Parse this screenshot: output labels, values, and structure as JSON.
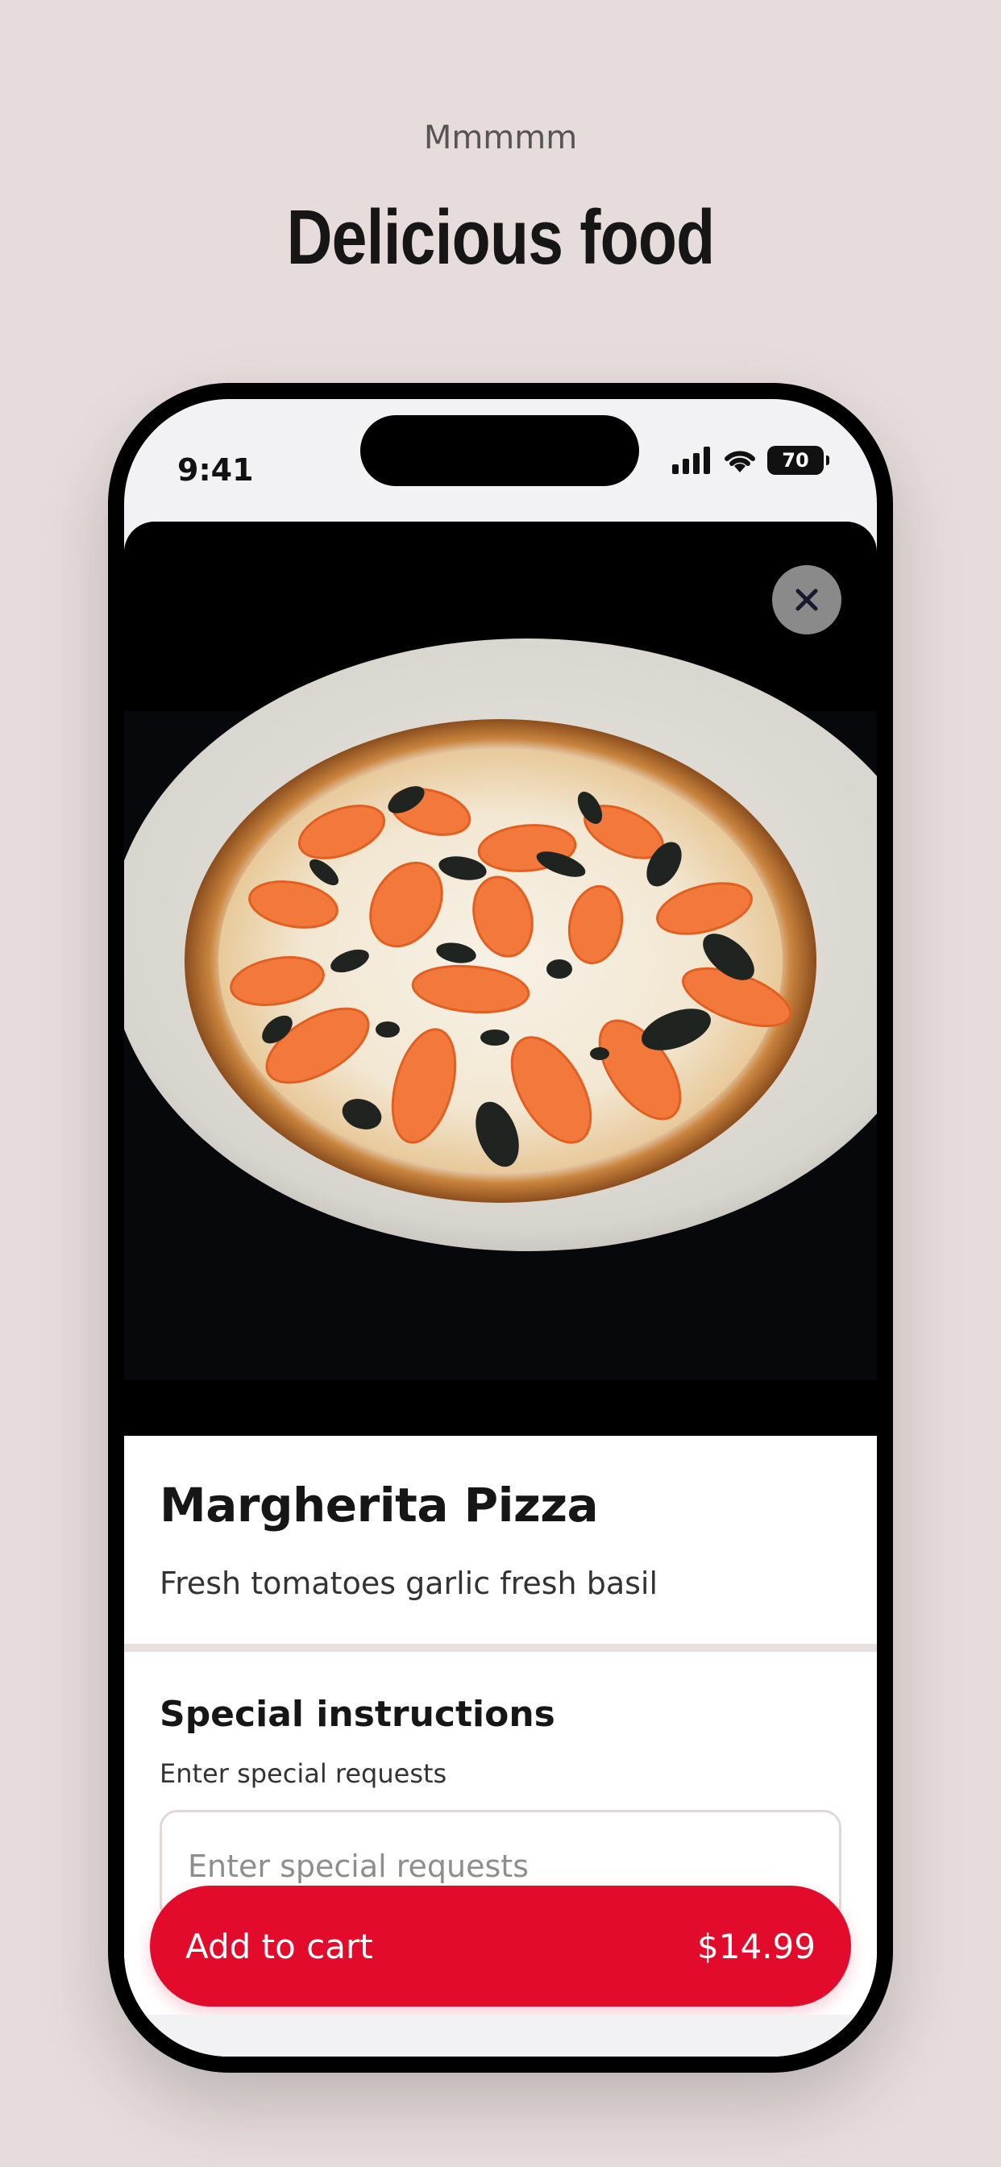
{
  "intro": {
    "eyebrow": "Mmmmm",
    "headline": "Delicious food"
  },
  "status_bar": {
    "time": "9:41",
    "battery": "70",
    "icons": [
      "cellular-signal-icon",
      "wifi-icon",
      "battery-icon"
    ]
  },
  "product": {
    "image_subject": "pizza-photo",
    "name": "Margherita Pizza",
    "description": "Fresh tomatoes garlic fresh basil"
  },
  "special_instructions": {
    "title": "Special instructions",
    "subtitle": "Enter special requests",
    "placeholder": "Enter special requests",
    "value": ""
  },
  "cart": {
    "label": "Add to cart",
    "price": "$14.99"
  },
  "colors": {
    "background": "#e6dcdc",
    "accent": "#e30b2c",
    "text": "#161616"
  }
}
